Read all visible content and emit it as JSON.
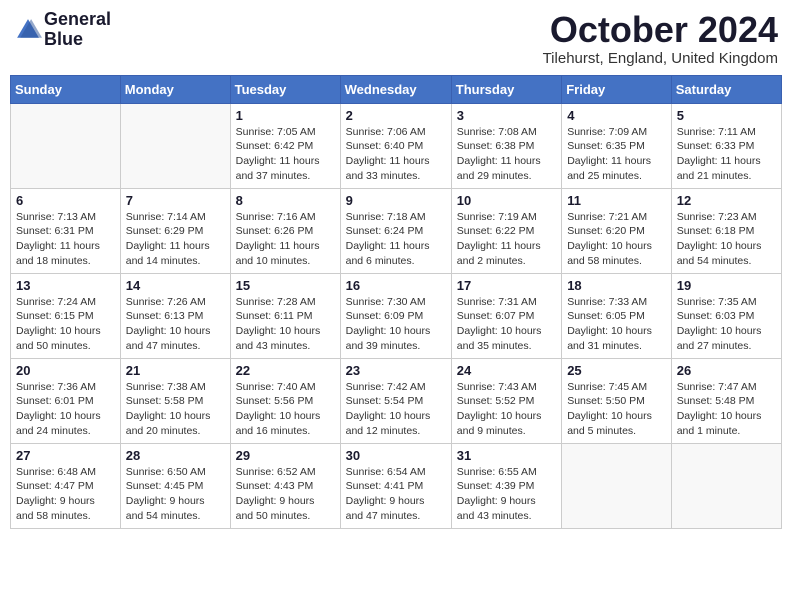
{
  "logo": {
    "line1": "General",
    "line2": "Blue"
  },
  "title": {
    "month": "October 2024",
    "location": "Tilehurst, England, United Kingdom"
  },
  "weekdays": [
    "Sunday",
    "Monday",
    "Tuesday",
    "Wednesday",
    "Thursday",
    "Friday",
    "Saturday"
  ],
  "weeks": [
    [
      {
        "day": "",
        "sunrise": "",
        "sunset": "",
        "daylight": ""
      },
      {
        "day": "",
        "sunrise": "",
        "sunset": "",
        "daylight": ""
      },
      {
        "day": "1",
        "sunrise": "Sunrise: 7:05 AM",
        "sunset": "Sunset: 6:42 PM",
        "daylight": "Daylight: 11 hours and 37 minutes."
      },
      {
        "day": "2",
        "sunrise": "Sunrise: 7:06 AM",
        "sunset": "Sunset: 6:40 PM",
        "daylight": "Daylight: 11 hours and 33 minutes."
      },
      {
        "day": "3",
        "sunrise": "Sunrise: 7:08 AM",
        "sunset": "Sunset: 6:38 PM",
        "daylight": "Daylight: 11 hours and 29 minutes."
      },
      {
        "day": "4",
        "sunrise": "Sunrise: 7:09 AM",
        "sunset": "Sunset: 6:35 PM",
        "daylight": "Daylight: 11 hours and 25 minutes."
      },
      {
        "day": "5",
        "sunrise": "Sunrise: 7:11 AM",
        "sunset": "Sunset: 6:33 PM",
        "daylight": "Daylight: 11 hours and 21 minutes."
      }
    ],
    [
      {
        "day": "6",
        "sunrise": "Sunrise: 7:13 AM",
        "sunset": "Sunset: 6:31 PM",
        "daylight": "Daylight: 11 hours and 18 minutes."
      },
      {
        "day": "7",
        "sunrise": "Sunrise: 7:14 AM",
        "sunset": "Sunset: 6:29 PM",
        "daylight": "Daylight: 11 hours and 14 minutes."
      },
      {
        "day": "8",
        "sunrise": "Sunrise: 7:16 AM",
        "sunset": "Sunset: 6:26 PM",
        "daylight": "Daylight: 11 hours and 10 minutes."
      },
      {
        "day": "9",
        "sunrise": "Sunrise: 7:18 AM",
        "sunset": "Sunset: 6:24 PM",
        "daylight": "Daylight: 11 hours and 6 minutes."
      },
      {
        "day": "10",
        "sunrise": "Sunrise: 7:19 AM",
        "sunset": "Sunset: 6:22 PM",
        "daylight": "Daylight: 11 hours and 2 minutes."
      },
      {
        "day": "11",
        "sunrise": "Sunrise: 7:21 AM",
        "sunset": "Sunset: 6:20 PM",
        "daylight": "Daylight: 10 hours and 58 minutes."
      },
      {
        "day": "12",
        "sunrise": "Sunrise: 7:23 AM",
        "sunset": "Sunset: 6:18 PM",
        "daylight": "Daylight: 10 hours and 54 minutes."
      }
    ],
    [
      {
        "day": "13",
        "sunrise": "Sunrise: 7:24 AM",
        "sunset": "Sunset: 6:15 PM",
        "daylight": "Daylight: 10 hours and 50 minutes."
      },
      {
        "day": "14",
        "sunrise": "Sunrise: 7:26 AM",
        "sunset": "Sunset: 6:13 PM",
        "daylight": "Daylight: 10 hours and 47 minutes."
      },
      {
        "day": "15",
        "sunrise": "Sunrise: 7:28 AM",
        "sunset": "Sunset: 6:11 PM",
        "daylight": "Daylight: 10 hours and 43 minutes."
      },
      {
        "day": "16",
        "sunrise": "Sunrise: 7:30 AM",
        "sunset": "Sunset: 6:09 PM",
        "daylight": "Daylight: 10 hours and 39 minutes."
      },
      {
        "day": "17",
        "sunrise": "Sunrise: 7:31 AM",
        "sunset": "Sunset: 6:07 PM",
        "daylight": "Daylight: 10 hours and 35 minutes."
      },
      {
        "day": "18",
        "sunrise": "Sunrise: 7:33 AM",
        "sunset": "Sunset: 6:05 PM",
        "daylight": "Daylight: 10 hours and 31 minutes."
      },
      {
        "day": "19",
        "sunrise": "Sunrise: 7:35 AM",
        "sunset": "Sunset: 6:03 PM",
        "daylight": "Daylight: 10 hours and 27 minutes."
      }
    ],
    [
      {
        "day": "20",
        "sunrise": "Sunrise: 7:36 AM",
        "sunset": "Sunset: 6:01 PM",
        "daylight": "Daylight: 10 hours and 24 minutes."
      },
      {
        "day": "21",
        "sunrise": "Sunrise: 7:38 AM",
        "sunset": "Sunset: 5:58 PM",
        "daylight": "Daylight: 10 hours and 20 minutes."
      },
      {
        "day": "22",
        "sunrise": "Sunrise: 7:40 AM",
        "sunset": "Sunset: 5:56 PM",
        "daylight": "Daylight: 10 hours and 16 minutes."
      },
      {
        "day": "23",
        "sunrise": "Sunrise: 7:42 AM",
        "sunset": "Sunset: 5:54 PM",
        "daylight": "Daylight: 10 hours and 12 minutes."
      },
      {
        "day": "24",
        "sunrise": "Sunrise: 7:43 AM",
        "sunset": "Sunset: 5:52 PM",
        "daylight": "Daylight: 10 hours and 9 minutes."
      },
      {
        "day": "25",
        "sunrise": "Sunrise: 7:45 AM",
        "sunset": "Sunset: 5:50 PM",
        "daylight": "Daylight: 10 hours and 5 minutes."
      },
      {
        "day": "26",
        "sunrise": "Sunrise: 7:47 AM",
        "sunset": "Sunset: 5:48 PM",
        "daylight": "Daylight: 10 hours and 1 minute."
      }
    ],
    [
      {
        "day": "27",
        "sunrise": "Sunrise: 6:48 AM",
        "sunset": "Sunset: 4:47 PM",
        "daylight": "Daylight: 9 hours and 58 minutes."
      },
      {
        "day": "28",
        "sunrise": "Sunrise: 6:50 AM",
        "sunset": "Sunset: 4:45 PM",
        "daylight": "Daylight: 9 hours and 54 minutes."
      },
      {
        "day": "29",
        "sunrise": "Sunrise: 6:52 AM",
        "sunset": "Sunset: 4:43 PM",
        "daylight": "Daylight: 9 hours and 50 minutes."
      },
      {
        "day": "30",
        "sunrise": "Sunrise: 6:54 AM",
        "sunset": "Sunset: 4:41 PM",
        "daylight": "Daylight: 9 hours and 47 minutes."
      },
      {
        "day": "31",
        "sunrise": "Sunrise: 6:55 AM",
        "sunset": "Sunset: 4:39 PM",
        "daylight": "Daylight: 9 hours and 43 minutes."
      },
      {
        "day": "",
        "sunrise": "",
        "sunset": "",
        "daylight": ""
      },
      {
        "day": "",
        "sunrise": "",
        "sunset": "",
        "daylight": ""
      }
    ]
  ]
}
